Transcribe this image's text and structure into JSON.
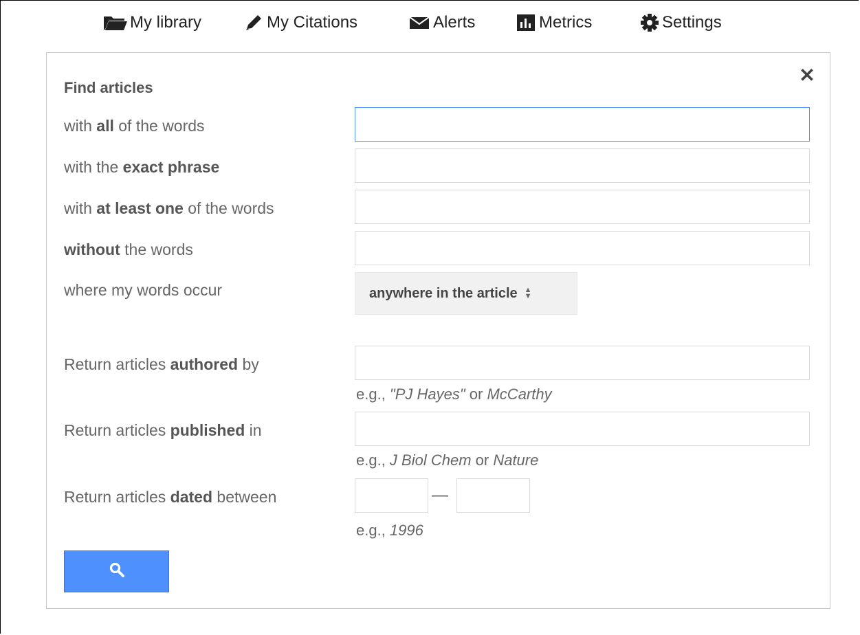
{
  "nav": {
    "items": [
      {
        "label": "My library",
        "icon": "folder-open-icon"
      },
      {
        "label": "My Citations",
        "icon": "pencil-icon"
      },
      {
        "label": "Alerts",
        "icon": "envelope-icon"
      },
      {
        "label": "Metrics",
        "icon": "metrics-chart-icon"
      },
      {
        "label": "Settings",
        "icon": "gear-icon"
      }
    ]
  },
  "dialog": {
    "close_label": "✕",
    "heading": "Find articles",
    "rows": {
      "all_words": {
        "pre": "with ",
        "bold": "all",
        "post": " of the words",
        "value": ""
      },
      "exact_phrase": {
        "pre": "with the ",
        "bold": "exact phrase",
        "post": "",
        "value": ""
      },
      "at_least_one": {
        "pre": "with ",
        "bold": "at least one",
        "post": " of the words",
        "value": ""
      },
      "without": {
        "pre": "",
        "bold": "without",
        "post": " the words",
        "value": ""
      }
    },
    "occur": {
      "label": "where my words occur",
      "selected": "anywhere in the article"
    },
    "authored": {
      "pre": "Return articles ",
      "bold": "authored",
      "post": " by",
      "hint_pre": "e.g., ",
      "hint_i1": "\"PJ Hayes\"",
      "hint_mid": " or ",
      "hint_i2": "McCarthy"
    },
    "published": {
      "pre": "Return articles ",
      "bold": "published",
      "post": " in",
      "hint_pre": "e.g., ",
      "hint_i1": "J Biol Chem",
      "hint_mid": " or ",
      "hint_i2": "Nature"
    },
    "dated": {
      "pre": "Return articles ",
      "bold": "dated",
      "post": " between",
      "separator": "—",
      "hint_pre": "e.g., ",
      "hint_i1": "1996"
    }
  },
  "colors": {
    "accent": "#4d90fe",
    "focus_border": "#4d90fe"
  }
}
